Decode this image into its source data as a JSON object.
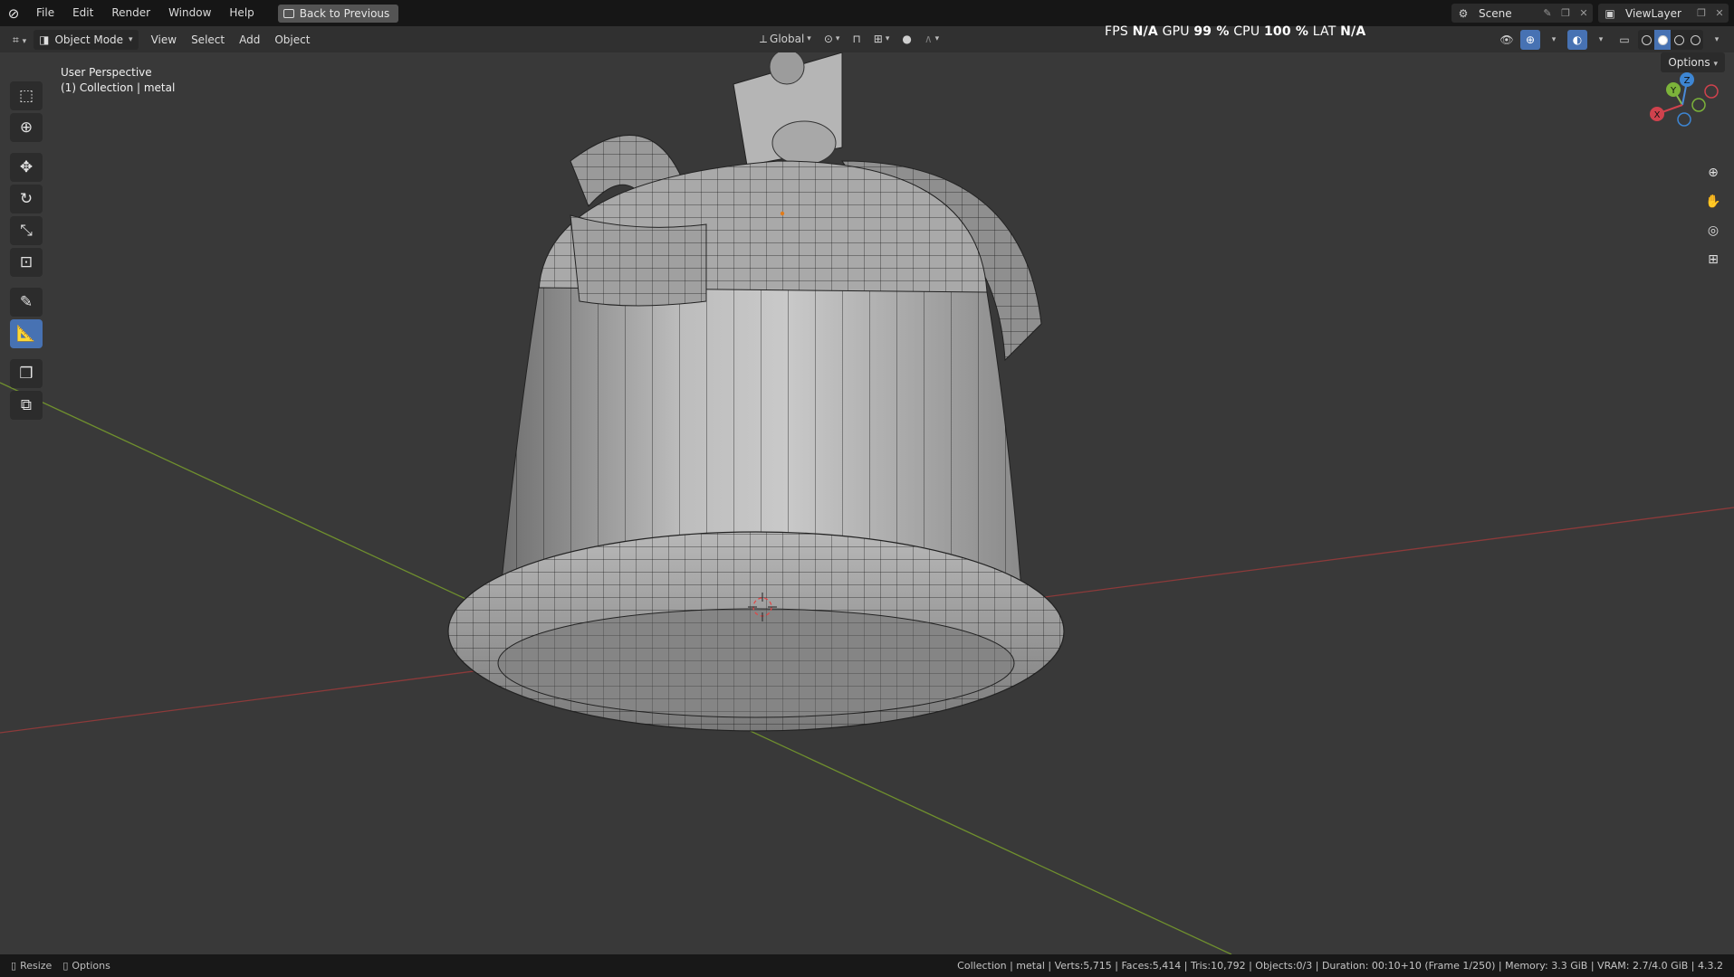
{
  "topbar": {
    "menu": [
      "File",
      "Edit",
      "Render",
      "Window",
      "Help"
    ],
    "back_button": "Back to Previous",
    "scene": "Scene",
    "view_layer": "ViewLayer"
  },
  "header": {
    "mode": "Object Mode",
    "menu": [
      "View",
      "Select",
      "Add",
      "Object"
    ],
    "transform_orientation": "Global",
    "stats": {
      "fps_label": "FPS",
      "fps_value": "N/A",
      "gpu_label": "GPU",
      "gpu_value": "99 %",
      "cpu_label": "CPU",
      "cpu_value": "100 %",
      "lat_label": "LAT",
      "lat_value": "N/A"
    }
  },
  "viewport": {
    "perspective": "User Perspective",
    "collection": "(1) Collection | metal",
    "options": "Options",
    "gizmo": {
      "x": "X",
      "y": "Y",
      "z": "Z"
    }
  },
  "statusbar": {
    "resize": "Resize",
    "options": "Options",
    "info": "Collection | metal | Verts:5,715 | Faces:5,414 | Tris:10,792 | Objects:0/3 | Duration: 00:10+10 (Frame 1/250) | Memory: 3.3 GiB | VRAM: 2.7/4.0 GiB | 4.3.2"
  },
  "colors": {
    "accent": "#4772b3",
    "x_axis": "#d0424d",
    "y_axis": "#7cb33a",
    "z_axis": "#3d86d4",
    "background": "#393939"
  }
}
